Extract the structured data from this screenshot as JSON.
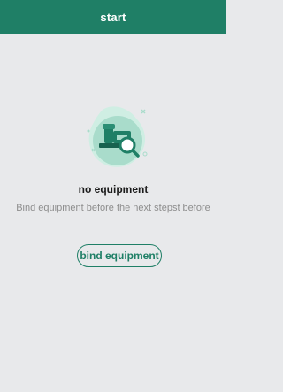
{
  "header": {
    "title": "start"
  },
  "empty_state": {
    "icon": "equipment-search-icon",
    "title": "no equipment",
    "description": "Bind equipment before the next stepst before"
  },
  "actions": {
    "bind_label": "bind equipment"
  },
  "colors": {
    "primary": "#1f7f66",
    "background": "#e8e9eb",
    "illustration_light": "#a9dccb",
    "title_text": "#1b1b1b",
    "muted_text": "#8d8d8d"
  }
}
